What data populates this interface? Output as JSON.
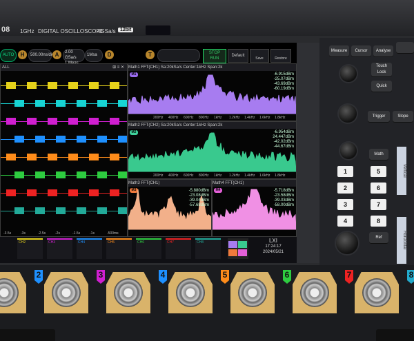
{
  "header": {
    "model": "08",
    "bandwidth": "1GHz",
    "product": "DIGITAL OSCILLOSCOPE",
    "sample_rate": "4GSa/s",
    "bits": "12bit"
  },
  "toolbar": {
    "auto": "AUTO",
    "h": "H",
    "timebase": "500.00ns/div",
    "a": "A",
    "acq_top": "2.00 GSa/s",
    "acq_bottom": "1 Meas",
    "acq_right": "1Msa",
    "d": "D",
    "t": "T",
    "stop_run_top": "STOP",
    "stop_run_bottom": "RUN",
    "default": "Default",
    "save": "Save",
    "restore": "Restore"
  },
  "panels": {
    "main": {
      "title": "ALL"
    },
    "math1": {
      "title": "Math1  FFT(CH1)  Sa:20kSa/s  Center:1kHz  Span:2k",
      "badge": "M1",
      "readouts": [
        "-6.915dBm",
        "-25.07dBm",
        "-43.69dBm",
        "-60.19dBm"
      ]
    },
    "math2": {
      "title": "Math2  FFT(CH2)  Sa:20kSa/s  Center:1kHz  Span:2k",
      "badge": "M2",
      "readouts": [
        "-6.954dBm",
        "24.447dBm",
        "-42.02dBm",
        "-44.67dBm"
      ]
    },
    "math3": {
      "title": "Math3  FFT(CH1)",
      "badge": "M3",
      "readouts": [
        "-5.880dBm",
        "-23.08dBm",
        "-39.04dBm",
        "-57.68dBm"
      ]
    },
    "math4": {
      "title": "Math4  FFT(CH1)",
      "badge": "M4",
      "readouts": [
        "-5.718dBm",
        "-23.58dBm",
        "-39.03dBm",
        "-58.00dBm"
      ]
    }
  },
  "freq_ticks": [
    "200Hz",
    "400Hz",
    "600Hz",
    "800Hz",
    "1kHz",
    "1.2kHz",
    "1.4kHz",
    "1.6kHz",
    "1.8kHz"
  ],
  "time_ticks": [
    "-3.5s",
    "-3s",
    "-2.5s",
    "-2s",
    "-1.5s",
    "-1s",
    "-500ms"
  ],
  "channels": [
    {
      "label": "CH2",
      "color": "#e6d21a"
    },
    {
      "label": "CH3",
      "color": "#d01fd0"
    },
    {
      "label": "CH4",
      "color": "#1e90ff"
    },
    {
      "label": "CH5",
      "color": "#ff8c1a"
    },
    {
      "label": "CH6",
      "color": "#2ecc40"
    },
    {
      "label": "CH7",
      "color": "#e22"
    },
    {
      "label": "CH8",
      "color": "#2a9"
    }
  ],
  "status": {
    "lxi": "LXI",
    "time": "17:24:17",
    "date": "2024/05/21"
  },
  "right_panel": {
    "measure": "Measure",
    "cursor": "Cursor",
    "analyse": "Analyse",
    "touch_top": "Touch",
    "touch_bottom": "Lock",
    "quick": "Quick",
    "trigger": "Trigger",
    "slope": "Slope",
    "math": "Math",
    "ref": "Ref",
    "vertical": "Vertical",
    "horizontal": "Horizontal",
    "numbers": [
      "1",
      "2",
      "3",
      "4",
      "5",
      "6",
      "7",
      "8"
    ]
  },
  "bnc_numbers": [
    "2",
    "3",
    "4",
    "5",
    "6",
    "7",
    "8"
  ],
  "bnc_colors": [
    "#1e90ff",
    "#d01fd0",
    "#1e90ff",
    "#ff8c1a",
    "#2ecc40",
    "#e22",
    "#2ac"
  ]
}
